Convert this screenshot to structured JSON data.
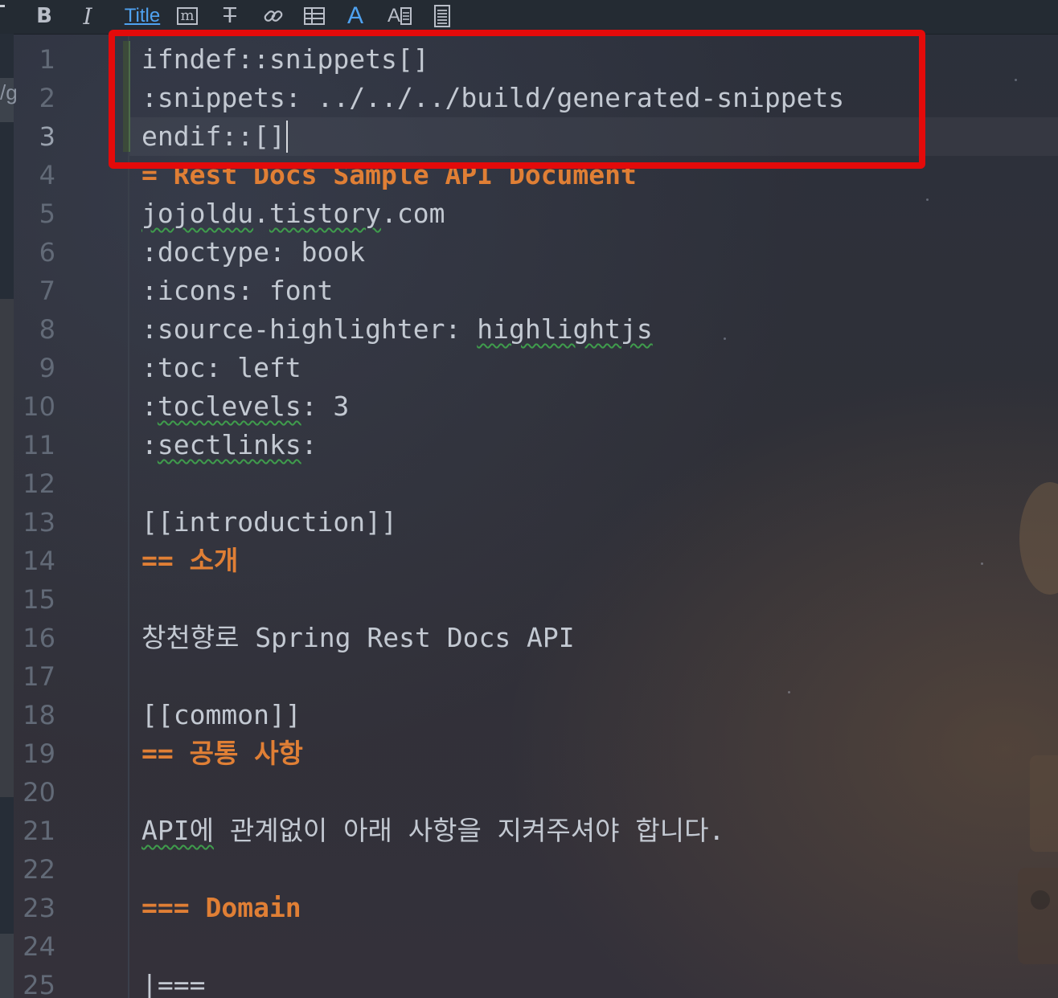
{
  "toolbar": {
    "bold": "B",
    "italic": "I",
    "title": "Title",
    "monospace": "m",
    "strike": "T",
    "font_color": "A",
    "font_size": "A",
    "icons": [
      "bold-icon",
      "italic-icon",
      "title-icon",
      "monospace-icon",
      "strikethrough-icon",
      "link-icon",
      "table-icon",
      "font-color-icon",
      "font-size-icon",
      "document-icon"
    ]
  },
  "strip": {
    "fragment": "/g"
  },
  "editor": {
    "line_numbers": [
      "1",
      "2",
      "3",
      "4",
      "5",
      "6",
      "7",
      "8",
      "9",
      "10",
      "11",
      "12",
      "13",
      "14",
      "15",
      "16",
      "17",
      "18",
      "19",
      "20",
      "21",
      "22",
      "23",
      "24",
      "25"
    ],
    "lines": {
      "l1": "ifndef::snippets[]",
      "l2": ":snippets: ../../../build/generated-snippets",
      "l3": "endif::[]",
      "l4": "= Rest Docs Sample API Document",
      "l5a": "jojoldu",
      "l5b": ".",
      "l5c": "tistory",
      "l5d": ".com",
      "l6": ":doctype: book",
      "l7": ":icons: font",
      "l8a": ":source-highlighter: ",
      "l8b": "highlightjs",
      "l9": ":toc: left",
      "l10a": ":",
      "l10b": "toclevels",
      "l10c": ": 3",
      "l11a": ":",
      "l11b": "sectlinks",
      "l11c": ":",
      "l13": "[[introduction]]",
      "l14": "== 소개",
      "l16": "창천향로 Spring Rest Docs API",
      "l18": "[[common]]",
      "l19": "== 공통 사항",
      "l21a": "API에",
      "l21b": " 관계없이 아래 사항을 지켜주셔야 합니다.",
      "l23": "=== Domain",
      "l25": "|==="
    }
  },
  "colors": {
    "background": "#2b2e38",
    "text": "#c3c9d2",
    "heading": "#e07f35",
    "line_number": "#626a77",
    "highlight_box": "#e40a0a",
    "title_link": "#4fa2f0",
    "spell_underline": "#3f9c4c"
  }
}
